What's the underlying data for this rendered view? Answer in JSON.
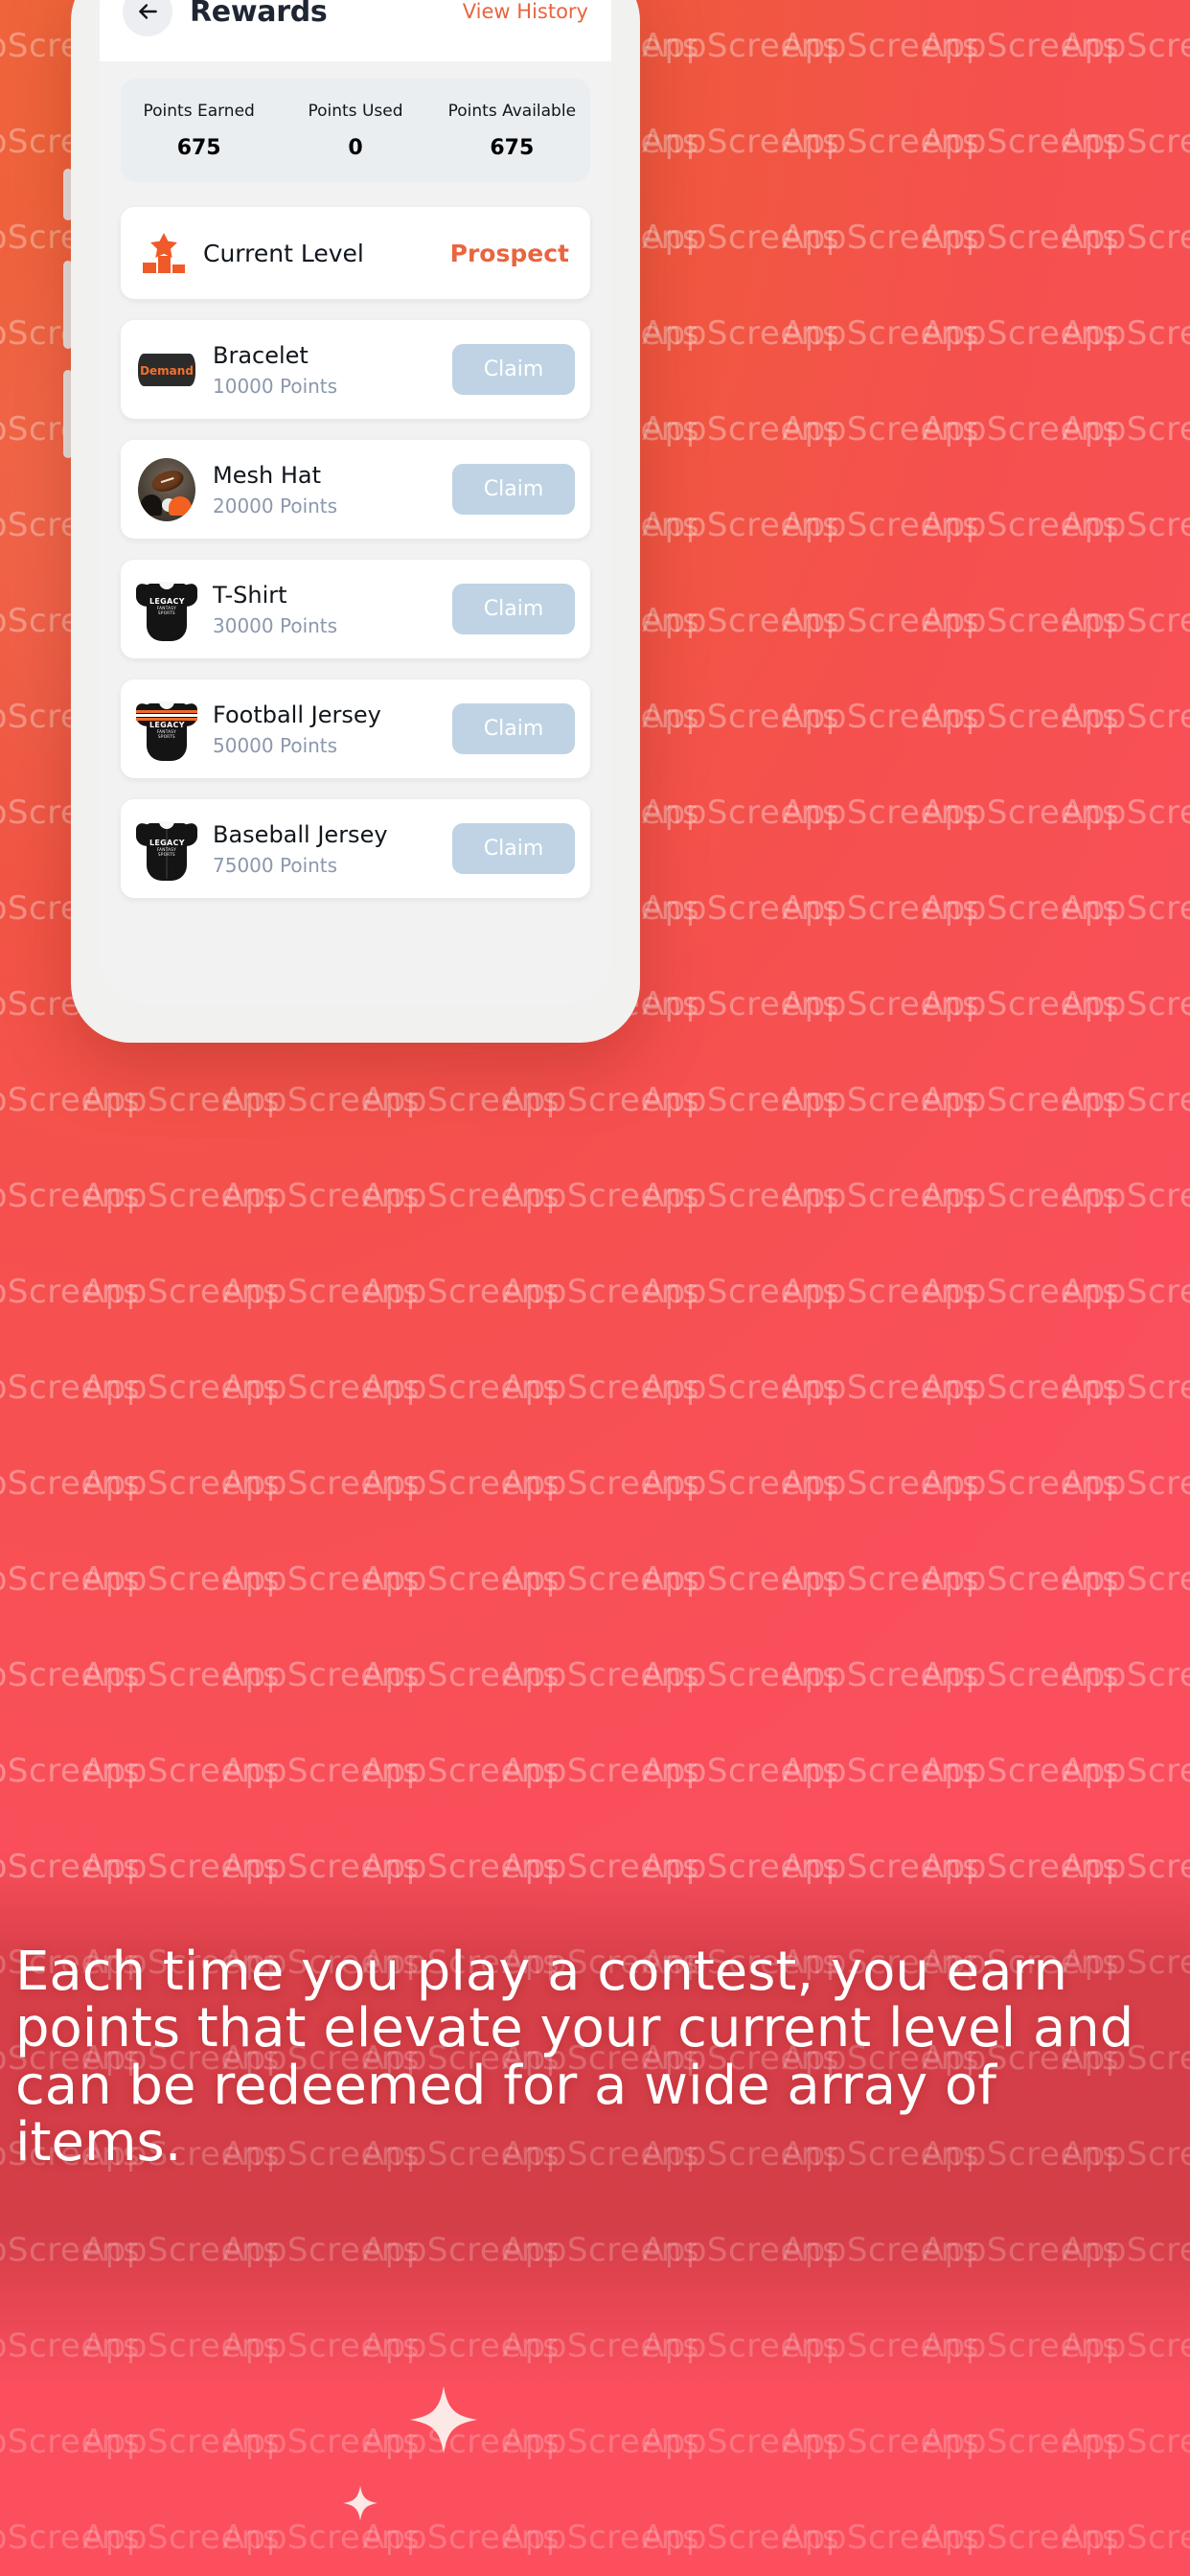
{
  "header": {
    "back_icon": "arrow-left-icon",
    "title": "Rewards",
    "view_history": "View History"
  },
  "stats": {
    "items": [
      {
        "label": "Points Earned",
        "value": "675"
      },
      {
        "label": "Points Used",
        "value": "0"
      },
      {
        "label": "Points Available",
        "value": "675"
      }
    ]
  },
  "level": {
    "icon": "podium-star-icon",
    "label": "Current Level",
    "value": "Prospect"
  },
  "rewards": {
    "claim_label": "Claim",
    "items": [
      {
        "name": "Bracelet",
        "points": "10000 Points",
        "thumb": "bracelet-thumbnail",
        "badge": "Demand"
      },
      {
        "name": "Mesh Hat",
        "points": "20000 Points",
        "thumb": "mesh-hat-thumbnail",
        "badge": ""
      },
      {
        "name": "T-Shirt",
        "points": "30000 Points",
        "thumb": "tshirt-thumbnail",
        "badge": "LEGACY"
      },
      {
        "name": "Football Jersey",
        "points": "50000 Points",
        "thumb": "football-jersey-thumbnail",
        "badge": "LEGACY"
      },
      {
        "name": "Baseball Jersey",
        "points": "75000 Points",
        "thumb": "baseball-jersey-thumbnail",
        "badge": "LEGACY"
      }
    ],
    "brand_name": "LEGACY",
    "brand_sub": "FANTASY SPORTS"
  },
  "caption": {
    "text": "Each time you play a contest, you earn points that elevate your current level and can be redeemed for a wide array of items."
  },
  "watermark": {
    "text": "AppScreens"
  },
  "colors": {
    "accent": "#e8653f",
    "bg_start": "#ef6333",
    "bg_end": "#fd4f62",
    "claim_bg": "#bfd3e4",
    "stats_bg": "#eaeef1"
  }
}
